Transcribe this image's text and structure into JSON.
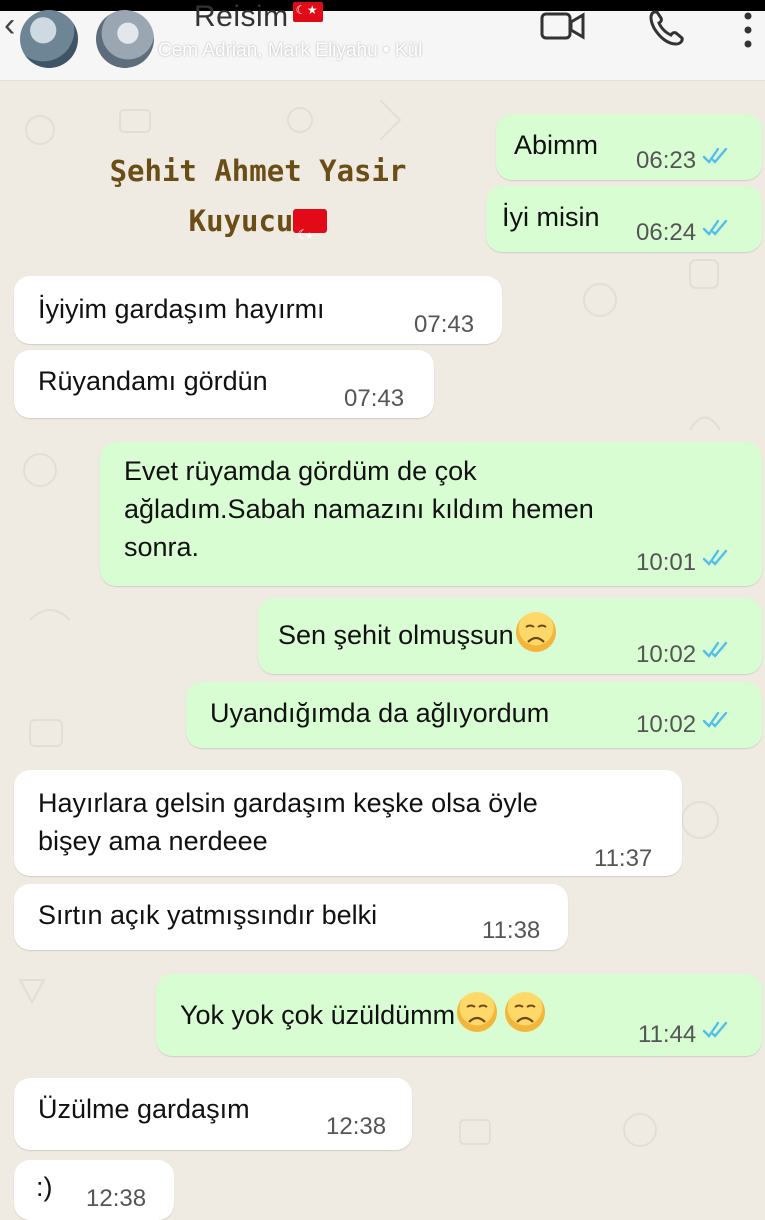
{
  "header": {
    "title": "Reisim",
    "participants": "Cem Adrian, Mark Eliyahu • Kül"
  },
  "watermark": {
    "line1": "Şehit Ahmet Yasir",
    "line2": "Kuyucu"
  },
  "messages": [
    {
      "dir": "out",
      "text": "Abimm",
      "time": "06:23",
      "emoji_count": 0
    },
    {
      "dir": "out",
      "text": "İyi misin",
      "time": "06:24",
      "emoji_count": 0
    },
    {
      "dir": "in",
      "text": "İyiyim gardaşım hayırmı",
      "time": "07:43",
      "emoji_count": 0
    },
    {
      "dir": "in",
      "text": "Rüyandamı gördün",
      "time": "07:43",
      "emoji_count": 0
    },
    {
      "dir": "out",
      "text_lines": [
        "Evet rüyamda gördüm de çok",
        "ağladım.Sabah namazını kıldım hemen",
        "sonra."
      ],
      "time": "10:01",
      "emoji_count": 0
    },
    {
      "dir": "out",
      "text": "Sen şehit olmuşsun",
      "time": "10:02",
      "emoji_count": 1
    },
    {
      "dir": "out",
      "text": "Uyandığımda da ağlıyordum",
      "time": "10:02",
      "emoji_count": 0
    },
    {
      "dir": "in",
      "text_lines": [
        "Hayırlara gelsin gardaşım keşke olsa öyle",
        "bişey ama nerdeee"
      ],
      "time": "11:37",
      "emoji_count": 0
    },
    {
      "dir": "in",
      "text": "Sırtın açık yatmışsındır belki",
      "time": "11:38",
      "emoji_count": 0
    },
    {
      "dir": "out",
      "text": "Yok yok çok üzüldümm",
      "time": "11:44",
      "emoji_count": 2
    },
    {
      "dir": "in",
      "text": "Üzülme gardaşım",
      "time": "12:38",
      "emoji_count": 0
    },
    {
      "dir": "in",
      "text": ":)",
      "time": "12:38",
      "emoji_count": 0
    }
  ],
  "colors": {
    "background": "#efeae2",
    "incoming": "#ffffff",
    "outgoing": "#d9fdd3",
    "read_ticks": "#53bdeb",
    "watermark": "#6b4e16",
    "flag_red": "#e30a17"
  },
  "icons": [
    "back-arrow-icon",
    "video-call-icon",
    "phone-icon",
    "more-options-icon",
    "double-check-icon",
    "sad-face-emoji"
  ]
}
